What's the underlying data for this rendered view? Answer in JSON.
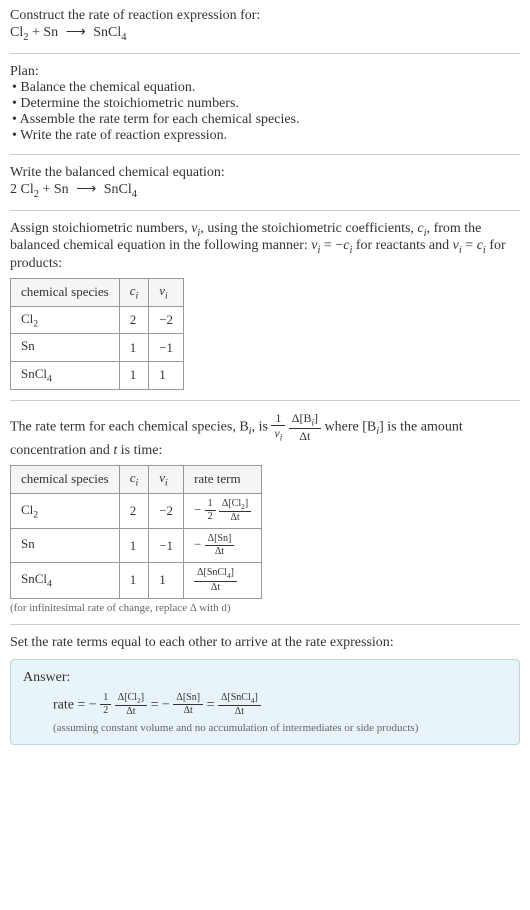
{
  "title": "Construct the rate of reaction expression for:",
  "equation_unbalanced": {
    "r1": "Cl",
    "r1sub": "2",
    "plus": " + ",
    "r2": "Sn",
    "arrow": "⟶",
    "p1": "SnCl",
    "p1sub": "4"
  },
  "plan": {
    "heading": "Plan:",
    "items": [
      "• Balance the chemical equation.",
      "• Determine the stoichiometric numbers.",
      "• Assemble the rate term for each chemical species.",
      "• Write the rate of reaction expression."
    ]
  },
  "balanced_heading": "Write the balanced chemical equation:",
  "equation_balanced": {
    "c1": "2 ",
    "r1": "Cl",
    "r1sub": "2",
    "plus": " + ",
    "r2": "Sn",
    "arrow": "⟶",
    "p1": "SnCl",
    "p1sub": "4"
  },
  "stoich_text": {
    "part1": "Assign stoichiometric numbers, ",
    "nu_i": "ν",
    "nu_i_sub": "i",
    "part2": ", using the stoichiometric coefficients, ",
    "c_i": "c",
    "c_i_sub": "i",
    "part3": ", from the balanced chemical equation in the following manner: ",
    "eq1_lhs": "ν",
    "eq1_lhs_sub": "i",
    "eq1_eq": " = −",
    "eq1_rhs": "c",
    "eq1_rhs_sub": "i",
    "part4": " for reactants and ",
    "eq2_lhs": "ν",
    "eq2_lhs_sub": "i",
    "eq2_eq": " = ",
    "eq2_rhs": "c",
    "eq2_rhs_sub": "i",
    "part5": " for products:"
  },
  "table1": {
    "headers": {
      "species": "chemical species",
      "ci": "c",
      "ci_sub": "i",
      "nui": "ν",
      "nui_sub": "i"
    },
    "rows": [
      {
        "species": "Cl",
        "species_sub": "2",
        "ci": "2",
        "nui": "−2"
      },
      {
        "species": "Sn",
        "species_sub": "",
        "ci": "1",
        "nui": "−1"
      },
      {
        "species": "SnCl",
        "species_sub": "4",
        "ci": "1",
        "nui": "1"
      }
    ]
  },
  "rate_text": {
    "part1": "The rate term for each chemical species, B",
    "Bi_sub": "i",
    "part2": ", is ",
    "frac1_num": "1",
    "frac1_den_v": "ν",
    "frac1_den_sub": "i",
    "frac2_num_d": "Δ[B",
    "frac2_num_sub": "i",
    "frac2_num_close": "]",
    "frac2_den": "Δt",
    "part3": " where [B",
    "part3_sub": "i",
    "part3_close": "] is the amount concentration and ",
    "t": "t",
    "part4": " is time:"
  },
  "table2": {
    "headers": {
      "species": "chemical species",
      "ci": "c",
      "ci_sub": "i",
      "nui": "ν",
      "nui_sub": "i",
      "rate": "rate term"
    },
    "rows": [
      {
        "species": "Cl",
        "species_sub": "2",
        "ci": "2",
        "nui": "−2",
        "rate_neg": "−",
        "rate_coef_num": "1",
        "rate_coef_den": "2",
        "rate_num": "Δ[Cl",
        "rate_num_sub": "2",
        "rate_num_close": "]",
        "rate_den": "Δt"
      },
      {
        "species": "Sn",
        "species_sub": "",
        "ci": "1",
        "nui": "−1",
        "rate_neg": "−",
        "rate_coef_num": "",
        "rate_coef_den": "",
        "rate_num": "Δ[Sn]",
        "rate_num_sub": "",
        "rate_num_close": "",
        "rate_den": "Δt"
      },
      {
        "species": "SnCl",
        "species_sub": "4",
        "ci": "1",
        "nui": "1",
        "rate_neg": "",
        "rate_coef_num": "",
        "rate_coef_den": "",
        "rate_num": "Δ[SnCl",
        "rate_num_sub": "4",
        "rate_num_close": "]",
        "rate_den": "Δt"
      }
    ]
  },
  "table2_caption": "(for infinitesimal rate of change, replace Δ with d)",
  "final_heading": "Set the rate terms equal to each other to arrive at the rate expression:",
  "answer": {
    "label": "Answer:",
    "rate_word": "rate = ",
    "t1_neg": "−",
    "t1_num": "1",
    "t1_den": "2",
    "t1_dnum": "Δ[Cl",
    "t1_dnum_sub": "2",
    "t1_dnum_close": "]",
    "t1_dden": "Δt",
    "eq": " = ",
    "t2_neg": "−",
    "t2_dnum": "Δ[Sn]",
    "t2_dden": "Δt",
    "t3_dnum": "Δ[SnCl",
    "t3_dnum_sub": "4",
    "t3_dnum_close": "]",
    "t3_dden": "Δt",
    "assumption": "(assuming constant volume and no accumulation of intermediates or side products)"
  },
  "chart_data": {
    "type": "table",
    "title": "Stoichiometric coefficients and rate terms for Cl2 + Sn → SnCl4",
    "stoichiometry_table": {
      "columns": [
        "chemical species",
        "c_i",
        "ν_i"
      ],
      "rows": [
        [
          "Cl2",
          2,
          -2
        ],
        [
          "Sn",
          1,
          -1
        ],
        [
          "SnCl4",
          1,
          1
        ]
      ]
    },
    "rate_terms_table": {
      "columns": [
        "chemical species",
        "c_i",
        "ν_i",
        "rate term"
      ],
      "rows": [
        [
          "Cl2",
          2,
          -2,
          "-(1/2) Δ[Cl2]/Δt"
        ],
        [
          "Sn",
          1,
          -1,
          "-Δ[Sn]/Δt"
        ],
        [
          "SnCl4",
          1,
          1,
          "Δ[SnCl4]/Δt"
        ]
      ]
    },
    "rate_expression": "rate = -(1/2) Δ[Cl2]/Δt = -Δ[Sn]/Δt = Δ[SnCl4]/Δt"
  }
}
